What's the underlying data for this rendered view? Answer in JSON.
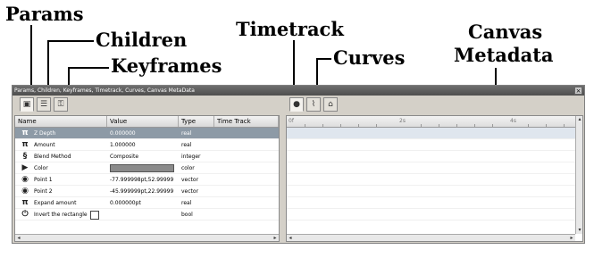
{
  "annotations": {
    "params": "Params",
    "children": "Children",
    "keyframes": "Keyframes",
    "timetrack": "Timetrack",
    "curves": "Curves",
    "canvas_metadata_line1": "Canvas",
    "canvas_metadata_line2": "Metadata"
  },
  "panel": {
    "title": "Params, Children, Keyframes, Timetrack, Curves, Canvas MetaData",
    "close": "×"
  },
  "params_table": {
    "headers": [
      "Name",
      "Value",
      "Type",
      "Time Track"
    ],
    "rows": [
      {
        "icon": "π",
        "name": "Z Depth",
        "value": "0.000000",
        "type": "real"
      },
      {
        "icon": "π",
        "name": "Amount",
        "value": "1.000000",
        "type": "real"
      },
      {
        "icon": "§",
        "name": "Blend Method",
        "value": "Composite",
        "type": "integer"
      },
      {
        "icon": "▶",
        "name": "Color",
        "value": "",
        "type": "color"
      },
      {
        "icon": "◉",
        "name": "Point 1",
        "value": "-77.999998pt,52.99999",
        "type": "vector"
      },
      {
        "icon": "◉",
        "name": "Point 2",
        "value": "-45.999999pt,22.99999",
        "type": "vector"
      },
      {
        "icon": "π",
        "name": "Expand amount",
        "value": "0.000000pt",
        "type": "real"
      },
      {
        "icon": "⏻",
        "name": "Invert the rectangle",
        "value": "",
        "type": "bool"
      }
    ]
  },
  "timeline": {
    "labels": [
      "0f",
      "2s",
      "4s"
    ]
  },
  "colors": {
    "selected_row": "#8d9aa6",
    "color_swatch": "#8a8a8a",
    "panel_bg": "#d4d0c8"
  }
}
